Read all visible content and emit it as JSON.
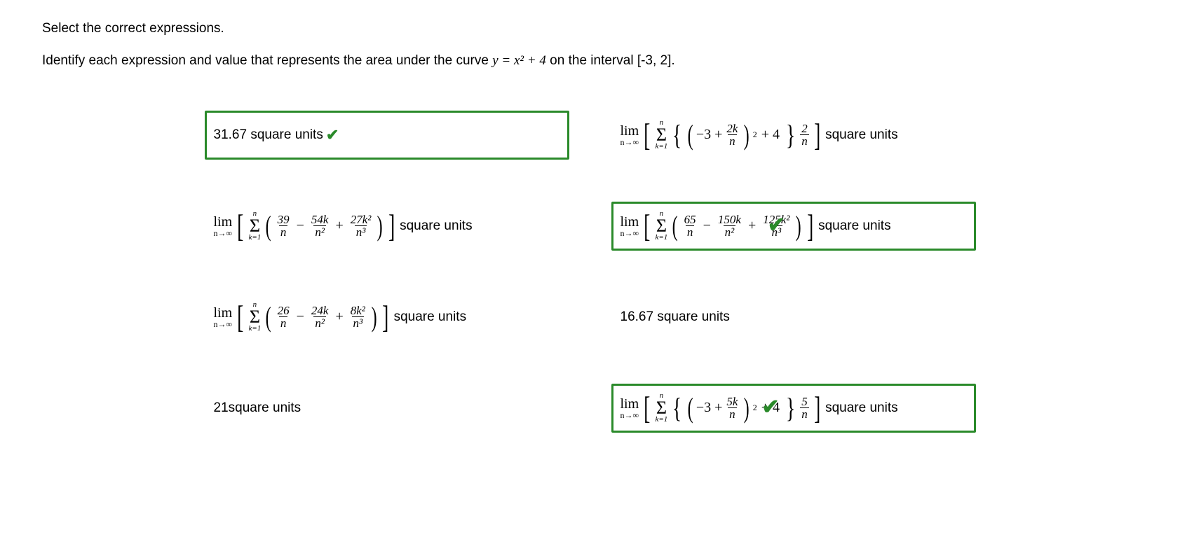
{
  "instruction": "Select the correct expressions.",
  "prompt_pre": "Identify each expression and value that represents the area under the curve ",
  "prompt_eq": "y = x² + 4",
  "prompt_post": " on the interval [-3, 2].",
  "units": "square units",
  "lim_top": "lim",
  "lim_bot": "n→∞",
  "sum_top": "n",
  "sum_bot": "k=1",
  "tiles": {
    "a": {
      "text": "31.67 square units "
    },
    "b": {
      "inner": "−3 +",
      "f1n": "2k",
      "f1d": "n",
      "exp": "2",
      "plus": "+ 4",
      "f2n": "2",
      "f2d": "n"
    },
    "c": {
      "f1n": "39",
      "f1d": "n",
      "minus1": "−",
      "f2n": "54k",
      "f2d": "n²",
      "plus": "+",
      "f3n": "27k²",
      "f3d": "n³"
    },
    "d": {
      "f1n": "65",
      "f1d": "n",
      "minus1": "−",
      "f2n": "150k",
      "f2d": "n²",
      "plus": "+",
      "f3n": "125k²",
      "f3d": "n³"
    },
    "e": {
      "f1n": "26",
      "f1d": "n",
      "minus1": "−",
      "f2n": "24k",
      "f2d": "n²",
      "plus": "+",
      "f3n": "8k²",
      "f3d": "n³"
    },
    "f": {
      "text": "16.67 square units"
    },
    "g": {
      "text": "21square units"
    },
    "h": {
      "inner": "−3 +",
      "f1n": "5k",
      "f1d": "n",
      "exp": "2",
      "plus": "+ 4",
      "f2n": "5",
      "f2d": "n"
    }
  }
}
